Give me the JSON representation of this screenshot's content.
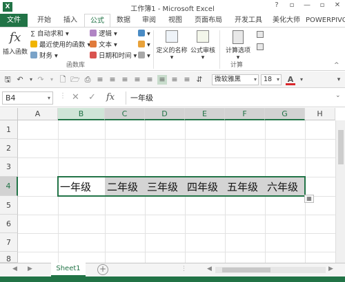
{
  "window": {
    "logo": "X",
    "title": "工作簿1 - Microsoft Excel",
    "controls": [
      "?",
      "▫",
      "—",
      "▫",
      "✕"
    ]
  },
  "tabs": [
    {
      "label": "文件"
    },
    {
      "label": "开始"
    },
    {
      "label": "插入"
    },
    {
      "label": "公式"
    },
    {
      "label": "数据"
    },
    {
      "label": "审阅"
    },
    {
      "label": "视图"
    },
    {
      "label": "页面布局"
    },
    {
      "label": "开发工具"
    },
    {
      "label": "美化大师"
    },
    {
      "label": "POWERPIVOT"
    }
  ],
  "active_tab": "公式",
  "ribbon": {
    "insert_function": {
      "icon": "fx",
      "label": "插入函数"
    },
    "autosum": "自动求和",
    "recent": "最近使用的函数",
    "financial": "财务",
    "logical": "逻辑",
    "text": "文本",
    "datetime": "日期和时间",
    "group_library": "函数库",
    "defined_names": "定义的名称",
    "formula_audit": "公式审核",
    "calc_options": "计算选项",
    "group_calc": "计算"
  },
  "format_bar": {
    "font_name": "微软雅黑",
    "font_size": "18"
  },
  "formula_bar": {
    "name_box": "B4",
    "fx": "fx",
    "content": "一年级"
  },
  "grid": {
    "columns": [
      "A",
      "B",
      "C",
      "D",
      "E",
      "F",
      "G",
      "H"
    ],
    "rows": [
      "1",
      "2",
      "3",
      "4",
      "5",
      "6",
      "7",
      "8"
    ],
    "row4": [
      "一年级",
      "二年级",
      "三年级",
      "四年级",
      "五年级",
      "六年级"
    ]
  },
  "sheets": [
    {
      "label": "Sheet1"
    }
  ],
  "colors": {
    "accent": "#217346",
    "selection": "#d4d4d4"
  }
}
